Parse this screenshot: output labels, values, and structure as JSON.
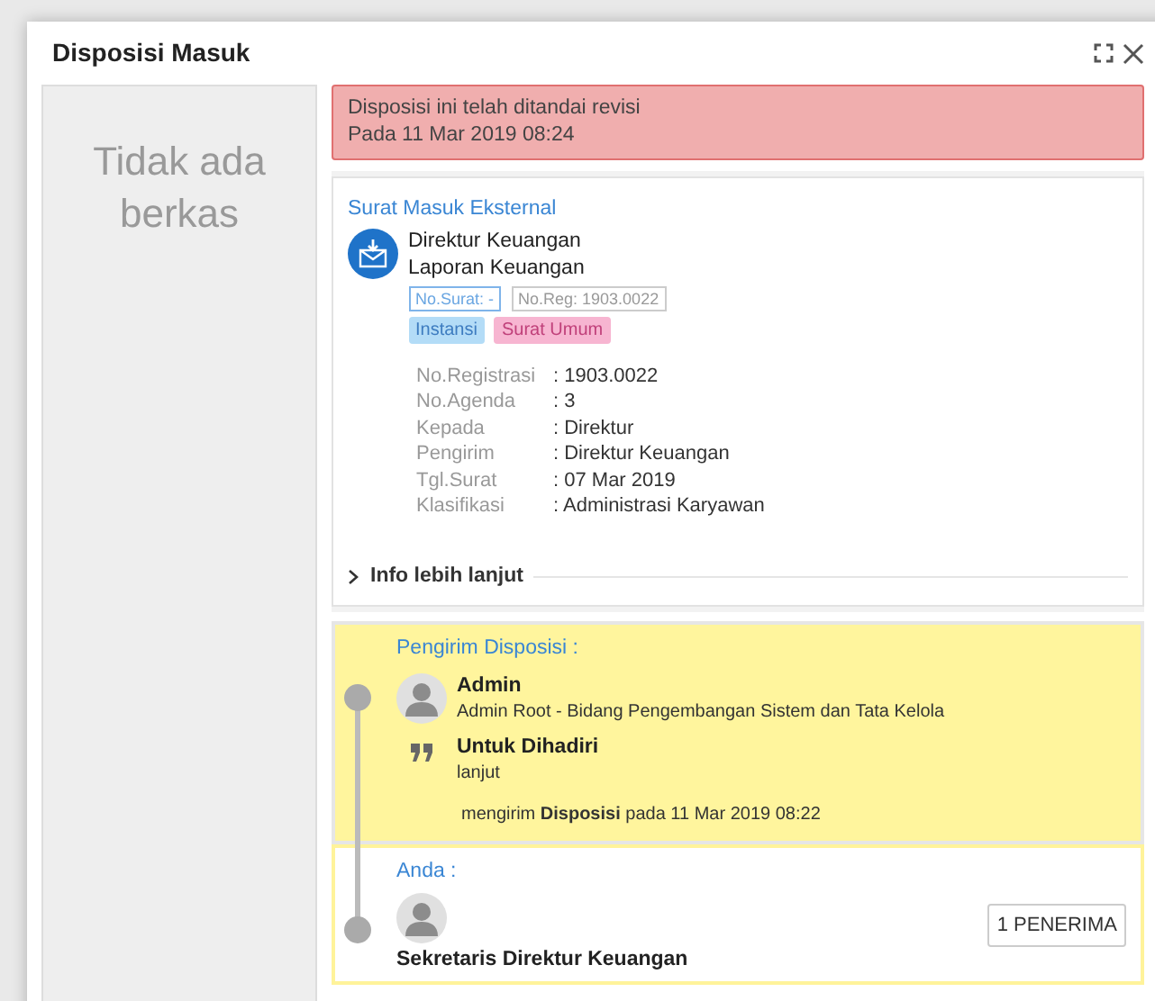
{
  "dialog": {
    "title": "Disposisi Masuk"
  },
  "files_panel": {
    "empty_text": "Tidak ada berkas"
  },
  "alert": {
    "lines": [
      "Disposisi ini telah ditandai revisi",
      "Pada 11 Mar 2019 08:24"
    ]
  },
  "letter": {
    "type": "Surat Masuk Eksternal",
    "lines": [
      "Direktur Keuangan",
      "Laporan Keuangan"
    ],
    "numbers": [
      {
        "text": "No.Surat: -",
        "kind": "primary"
      },
      {
        "text": "No.Reg: 1903.0022",
        "kind": "muted"
      }
    ],
    "tags": [
      {
        "text": "Instansi",
        "color": "#b3dcf7"
      },
      {
        "text": "Surat Umum",
        "color": "#f7b5d1"
      }
    ],
    "fields": [
      {
        "label": "No.Registrasi",
        "value": ": 1903.0022"
      },
      {
        "label": "No.Agenda",
        "value": ": 3"
      },
      {
        "label": "Kepada",
        "value": ": Direktur"
      },
      {
        "label": "Pengirim",
        "value": ": Direktur Keuangan"
      },
      {
        "label": "Tgl.Surat",
        "value": ": 07 Mar 2019"
      },
      {
        "label": "Klasifikasi",
        "value": ": Administrasi Karyawan"
      }
    ],
    "more_info": {
      "label": "Info lebih lanjut",
      "expanded": false
    }
  },
  "timeline": [
    {
      "heading": "Pengirim Disposisi :",
      "highlighted": true,
      "name": "Admin",
      "detail": "Admin Root - Bidang Pengembangan Sistem dan Tata Kelola",
      "instruction": "Untuk Dihadiri",
      "note": "lanjut",
      "footer": "mengirim **Disposisi** pada 11 Mar 2019 08:22"
    },
    {
      "heading": "Anda :",
      "highlighted": false,
      "name": "Sekretaris Direktur Keuangan",
      "recipients_button": "1 PENERIMA"
    }
  ]
}
